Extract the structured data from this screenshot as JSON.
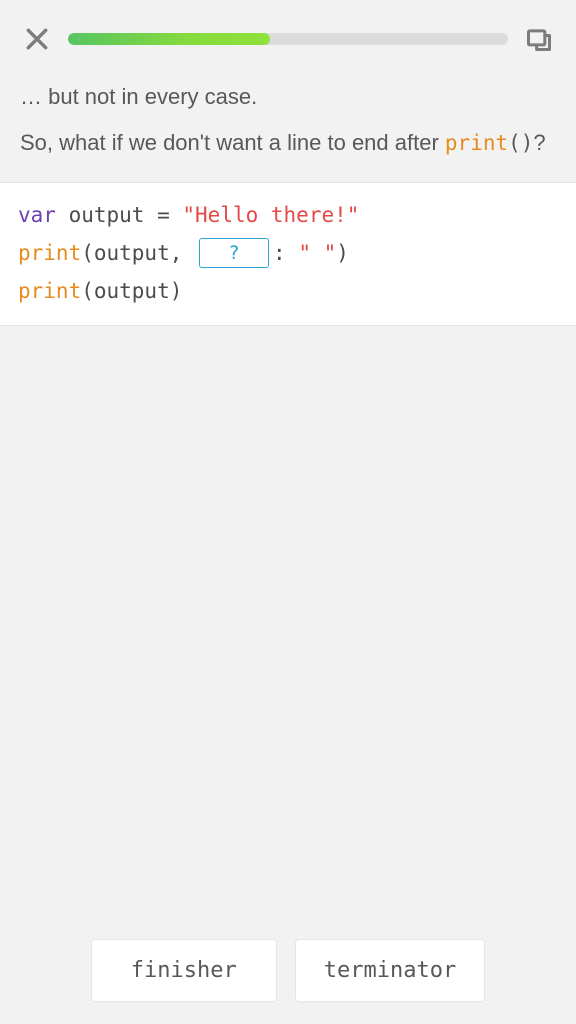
{
  "progress": {
    "percent": 46
  },
  "lesson": {
    "line1": "… but not in every case.",
    "line2_a": "So, what if we don't want a line to end after ",
    "line2_fn": "print",
    "line2_b": "()",
    "line2_c": "?"
  },
  "code": {
    "l1": {
      "kw": "var",
      "ident": " output ",
      "eq": "= ",
      "str": "\"Hello there!\""
    },
    "l2": {
      "fn": "print",
      "a": "(output, ",
      "slot_placeholder": "?",
      "b": ": ",
      "str": "\" \"",
      "c": ")"
    },
    "l3": {
      "fn": "print",
      "a": "(output)"
    }
  },
  "answers": {
    "opt1": "finisher",
    "opt2": "terminator"
  }
}
